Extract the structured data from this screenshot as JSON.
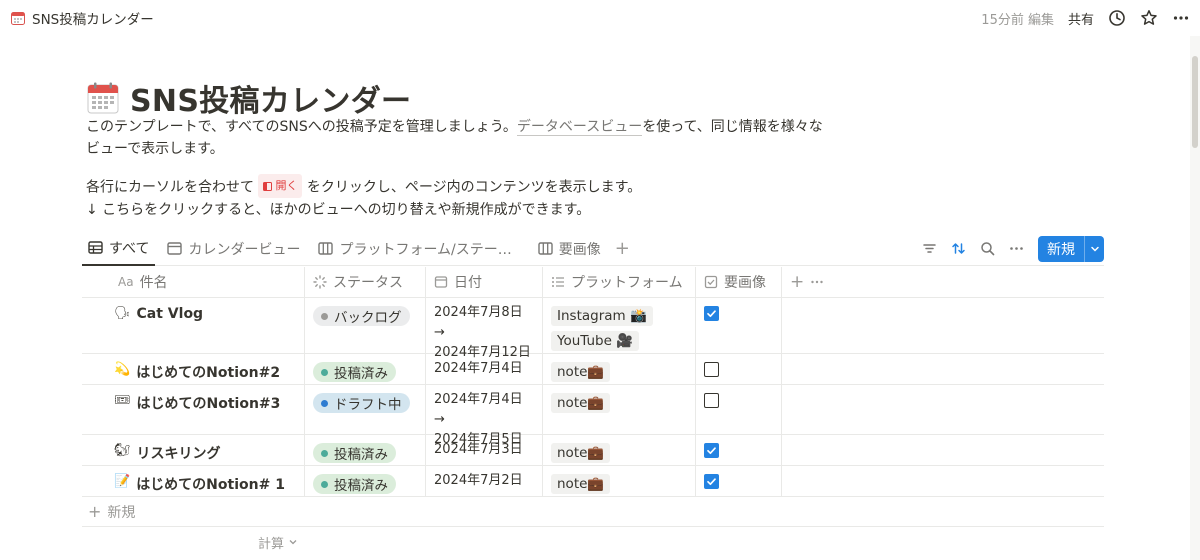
{
  "topbar": {
    "page_name": "SNS投稿カレンダー",
    "edited": "15分前 編集",
    "share": "共有",
    "icons": [
      "calendar-icon",
      "history-icon",
      "star-icon",
      "more-icon"
    ]
  },
  "header": {
    "title": "SNS投稿カレンダー",
    "desc_before_link": "このテンプレートで、すべてのSNSへの投稿予定を管理しましょう。",
    "desc_link": "データベースビュー",
    "desc_after_link": "を使って、同じ情報を様々なビューで表示します。",
    "desc2_before_chip": "各行にカーソルを合わせて",
    "open_chip": "開く",
    "desc2_after_chip": "をクリックし、ページ内のコンテンツを表示します。",
    "desc3": "↓ こちらをクリックすると、ほかのビューへの切り替えや新規作成ができます。"
  },
  "tabs": [
    {
      "label": "すべて",
      "icon": "table-icon",
      "active": true
    },
    {
      "label": "カレンダービュー",
      "icon": "calendar-view-icon",
      "active": false
    },
    {
      "label": "プラットフォーム/ステー…",
      "icon": "board-icon",
      "active": false
    },
    {
      "label": "要画像",
      "icon": "board-icon",
      "active": false
    }
  ],
  "toolbar": {
    "new_label": "新規",
    "icons": [
      "filter-icon",
      "sort-icon",
      "search-icon",
      "more-icon",
      "chevron-down-icon"
    ]
  },
  "columns": {
    "name": "件名",
    "name_prefix": "Aa",
    "status": "ステータス",
    "date": "日付",
    "platform": "プラットフォーム",
    "needs_image": "要画像"
  },
  "rows": [
    {
      "icon": "🗣",
      "name": "Cat Vlog",
      "status": "バックログ",
      "status_color": "#9b9a97",
      "status_bg": "#ebeced",
      "date1": "2024年7月8日 →",
      "date2": "2024年7月12日",
      "platforms": [
        "Instagram 📸",
        "YouTube 🎥"
      ],
      "needs_image": true
    },
    {
      "icon": "💫",
      "name": "はじめてのNotion#2",
      "status": "投稿済み",
      "status_color": "#4dab9a",
      "status_bg": "#dbeddb",
      "date1": "2024年7月4日",
      "date2": "",
      "platforms": [
        "note💼"
      ],
      "needs_image": false
    },
    {
      "icon": "🎟",
      "name": "はじめてのNotion#3",
      "status": "ドラフト中",
      "status_color": "#2e7cd1",
      "status_bg": "#d3e5ef",
      "date1": "2024年7月4日 →",
      "date2": "2024年7月5日",
      "platforms": [
        "note💼"
      ],
      "needs_image": false
    },
    {
      "icon": "🐿",
      "name": "リスキリング",
      "status": "投稿済み",
      "status_color": "#4dab9a",
      "status_bg": "#dbeddb",
      "date1": "2024年7月3日",
      "date2": "",
      "platforms": [
        "note💼"
      ],
      "needs_image": true
    },
    {
      "icon": "📝",
      "name": "はじめてのNotion# 1",
      "status": "投稿済み",
      "status_color": "#4dab9a",
      "status_bg": "#dbeddb",
      "date1": "2024年7月2日",
      "date2": "",
      "platforms": [
        "note💼"
      ],
      "needs_image": true
    }
  ],
  "footer": {
    "new_row": "新規",
    "calc": "計算"
  },
  "colors": {
    "accent": "#2383e2",
    "text": "#37352f",
    "muted": "#787774"
  }
}
